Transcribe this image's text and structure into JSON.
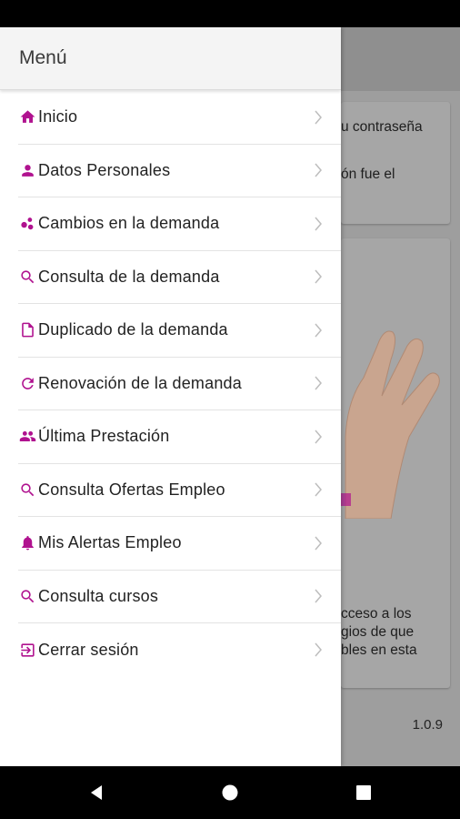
{
  "background": {
    "card1_text": [
      "u contraseña",
      "",
      "ón fue el"
    ],
    "card2_text": [
      "cceso a los",
      "gios de que",
      "bles en esta"
    ],
    "version": "1.0.9"
  },
  "drawer": {
    "title": "Menú",
    "items": [
      {
        "label": "Inicio",
        "icon": "home-icon"
      },
      {
        "label": "Datos Personales",
        "icon": "person-icon"
      },
      {
        "label": "Cambios en la demanda",
        "icon": "bubbles-icon"
      },
      {
        "label": "Consulta de la demanda",
        "icon": "search-icon"
      },
      {
        "label": "Duplicado de la demanda",
        "icon": "document-icon"
      },
      {
        "label": "Renovación de la demanda",
        "icon": "refresh-icon"
      },
      {
        "label": "Última Prestación",
        "icon": "people-icon"
      },
      {
        "label": "Consulta Ofertas Empleo",
        "icon": "search-icon"
      },
      {
        "label": "Mis Alertas Empleo",
        "icon": "bell-icon"
      },
      {
        "label": "Consulta cursos",
        "icon": "search-icon"
      },
      {
        "label": "Cerrar sesión",
        "icon": "logout-icon"
      }
    ]
  },
  "colors": {
    "accent": "#b0128f",
    "drawer_bg": "#ffffff",
    "scrim": "#9e9e9e"
  }
}
